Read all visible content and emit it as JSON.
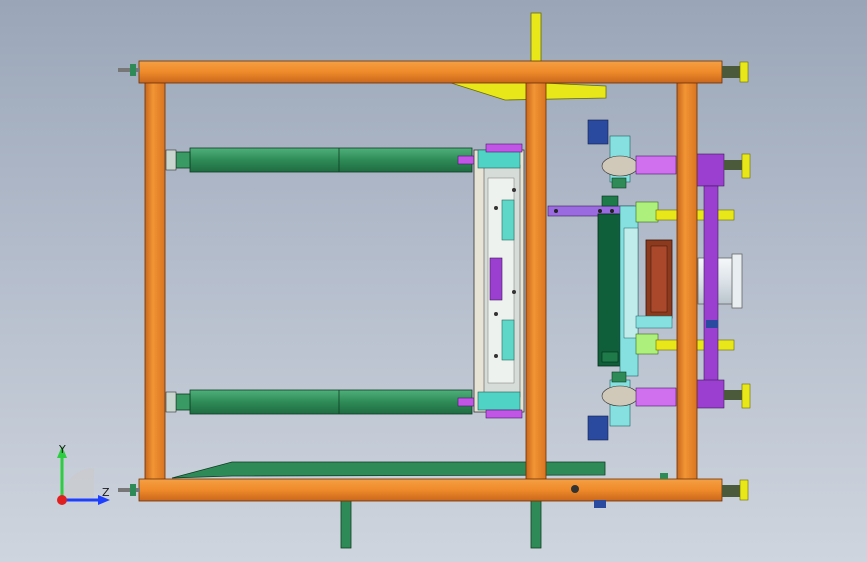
{
  "app": {
    "window_title": ""
  },
  "viewport": {
    "background_top": "#9aa6b8",
    "background_bottom": "#cfd5de"
  },
  "triad": {
    "y_label": "Y",
    "z_label": "Z"
  },
  "colors": {
    "frame_orange": "#ef8a2a",
    "cylinder_green": "#2e8b57",
    "rail_yellow": "#e7e71a",
    "bracket_purple": "#9a3fd0",
    "plate_grey": "#dcdcd4",
    "motor_brown": "#8b3a1e",
    "cylinder_light": "#e8edf0",
    "bearing_blue": "#2a4aa0",
    "triad_y": "#2ecc40",
    "triad_z": "#1f3fff"
  }
}
